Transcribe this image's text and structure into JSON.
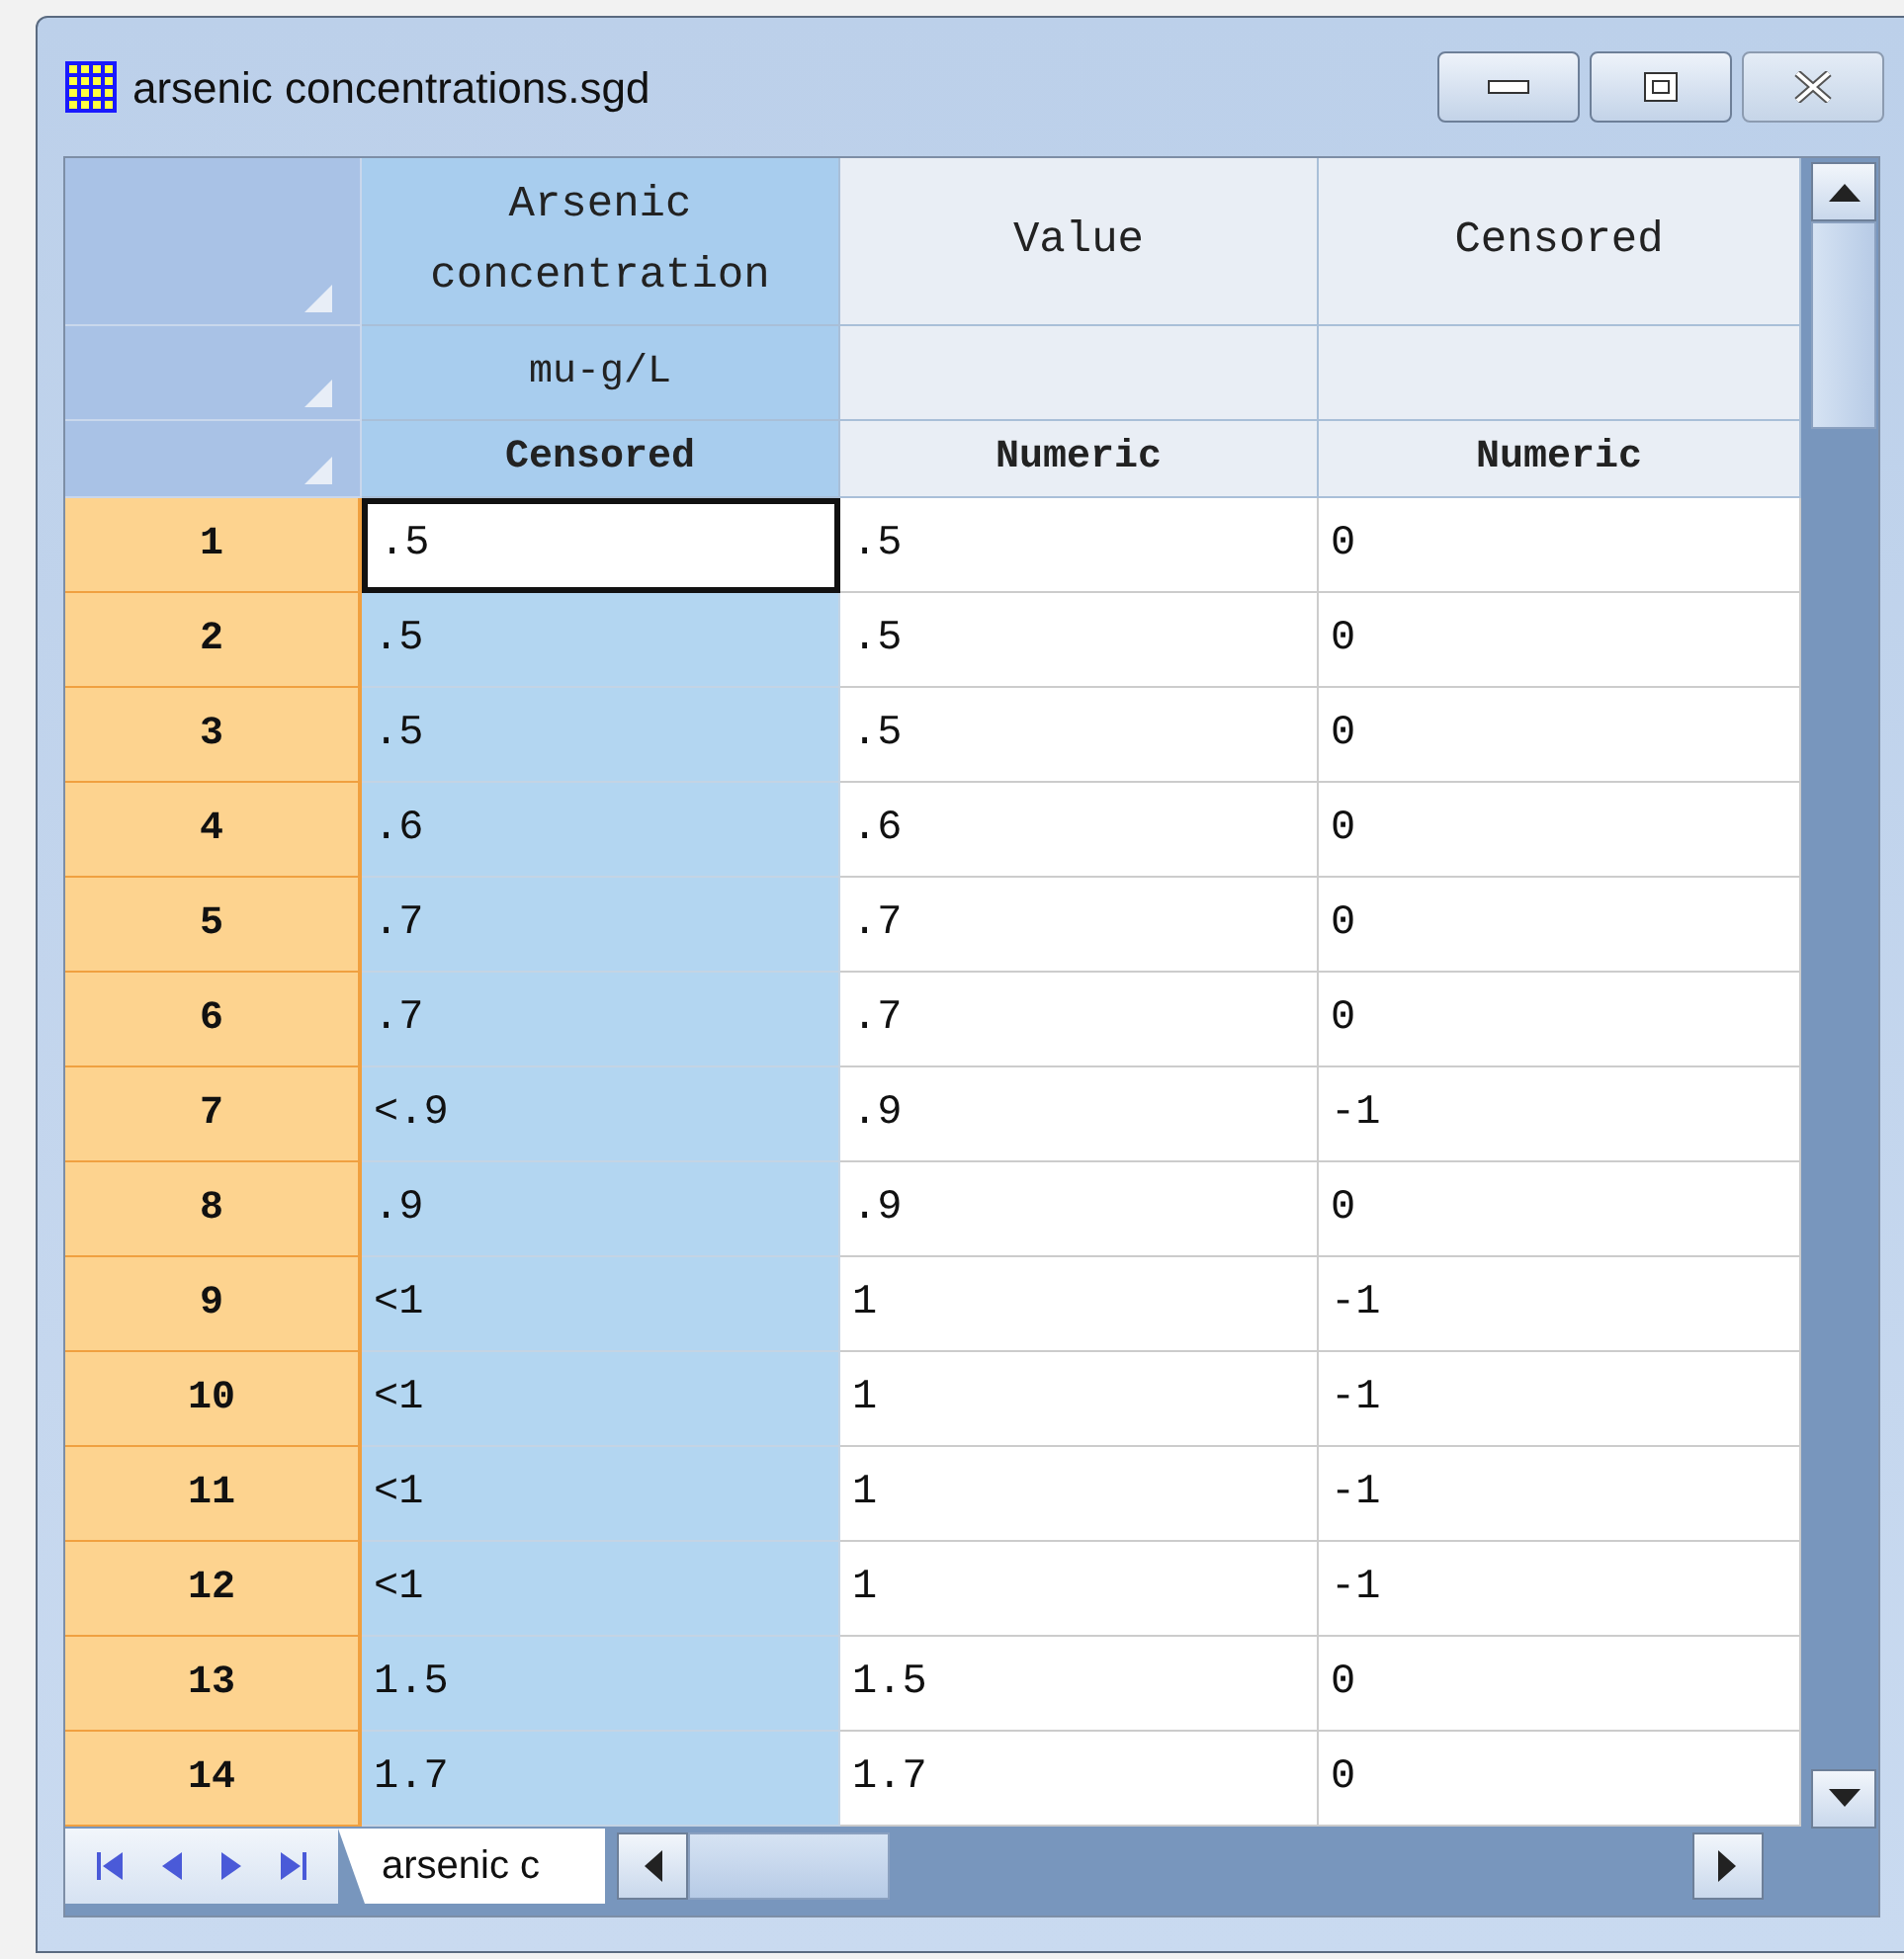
{
  "window": {
    "title": "arsenic concentrations.sgd"
  },
  "columns": [
    {
      "name": "Arsenic concentration",
      "unit": "mu-g/L",
      "type": "Censored",
      "selected": true
    },
    {
      "name": "Value",
      "type": "Numeric",
      "selected": false
    },
    {
      "name": "Censored",
      "type": "Numeric",
      "selected": false
    }
  ],
  "rows": [
    {
      "label": "1",
      "cells": [
        {
          "value": ".5",
          "active": true
        },
        {
          "value": ".5",
          "active": false
        },
        {
          "value": "0",
          "active": false
        }
      ]
    },
    {
      "label": "2",
      "cells": [
        {
          "value": ".5",
          "active": false
        },
        {
          "value": ".5",
          "active": false
        },
        {
          "value": "0",
          "active": false
        }
      ]
    },
    {
      "label": "3",
      "cells": [
        {
          "value": ".5",
          "active": false
        },
        {
          "value": ".5",
          "active": false
        },
        {
          "value": "0",
          "active": false
        }
      ]
    },
    {
      "label": "4",
      "cells": [
        {
          "value": ".6",
          "active": false
        },
        {
          "value": ".6",
          "active": false
        },
        {
          "value": "0",
          "active": false
        }
      ]
    },
    {
      "label": "5",
      "cells": [
        {
          "value": ".7",
          "active": false
        },
        {
          "value": ".7",
          "active": false
        },
        {
          "value": "0",
          "active": false
        }
      ]
    },
    {
      "label": "6",
      "cells": [
        {
          "value": ".7",
          "active": false
        },
        {
          "value": ".7",
          "active": false
        },
        {
          "value": "0",
          "active": false
        }
      ]
    },
    {
      "label": "7",
      "cells": [
        {
          "value": "<.9",
          "active": false
        },
        {
          "value": ".9",
          "active": false
        },
        {
          "value": "-1",
          "active": false
        }
      ]
    },
    {
      "label": "8",
      "cells": [
        {
          "value": ".9",
          "active": false
        },
        {
          "value": ".9",
          "active": false
        },
        {
          "value": "0",
          "active": false
        }
      ]
    },
    {
      "label": "9",
      "cells": [
        {
          "value": "<1",
          "active": false
        },
        {
          "value": "1",
          "active": false
        },
        {
          "value": "-1",
          "active": false
        }
      ]
    },
    {
      "label": "10",
      "cells": [
        {
          "value": "<1",
          "active": false
        },
        {
          "value": "1",
          "active": false
        },
        {
          "value": "-1",
          "active": false
        }
      ]
    },
    {
      "label": "11",
      "cells": [
        {
          "value": "<1",
          "active": false
        },
        {
          "value": "1",
          "active": false
        },
        {
          "value": "-1",
          "active": false
        }
      ]
    },
    {
      "label": "12",
      "cells": [
        {
          "value": "<1",
          "active": false
        },
        {
          "value": "1",
          "active": false
        },
        {
          "value": "-1",
          "active": false
        }
      ]
    },
    {
      "label": "13",
      "cells": [
        {
          "value": "1.5",
          "active": false
        },
        {
          "value": "1.5",
          "active": false
        },
        {
          "value": "0",
          "active": false
        }
      ]
    },
    {
      "label": "14",
      "cells": [
        {
          "value": "1.7",
          "active": false
        },
        {
          "value": "1.7",
          "active": false
        },
        {
          "value": "0",
          "active": false
        }
      ]
    }
  ],
  "sheet_tab": {
    "label": "arsenic c"
  }
}
